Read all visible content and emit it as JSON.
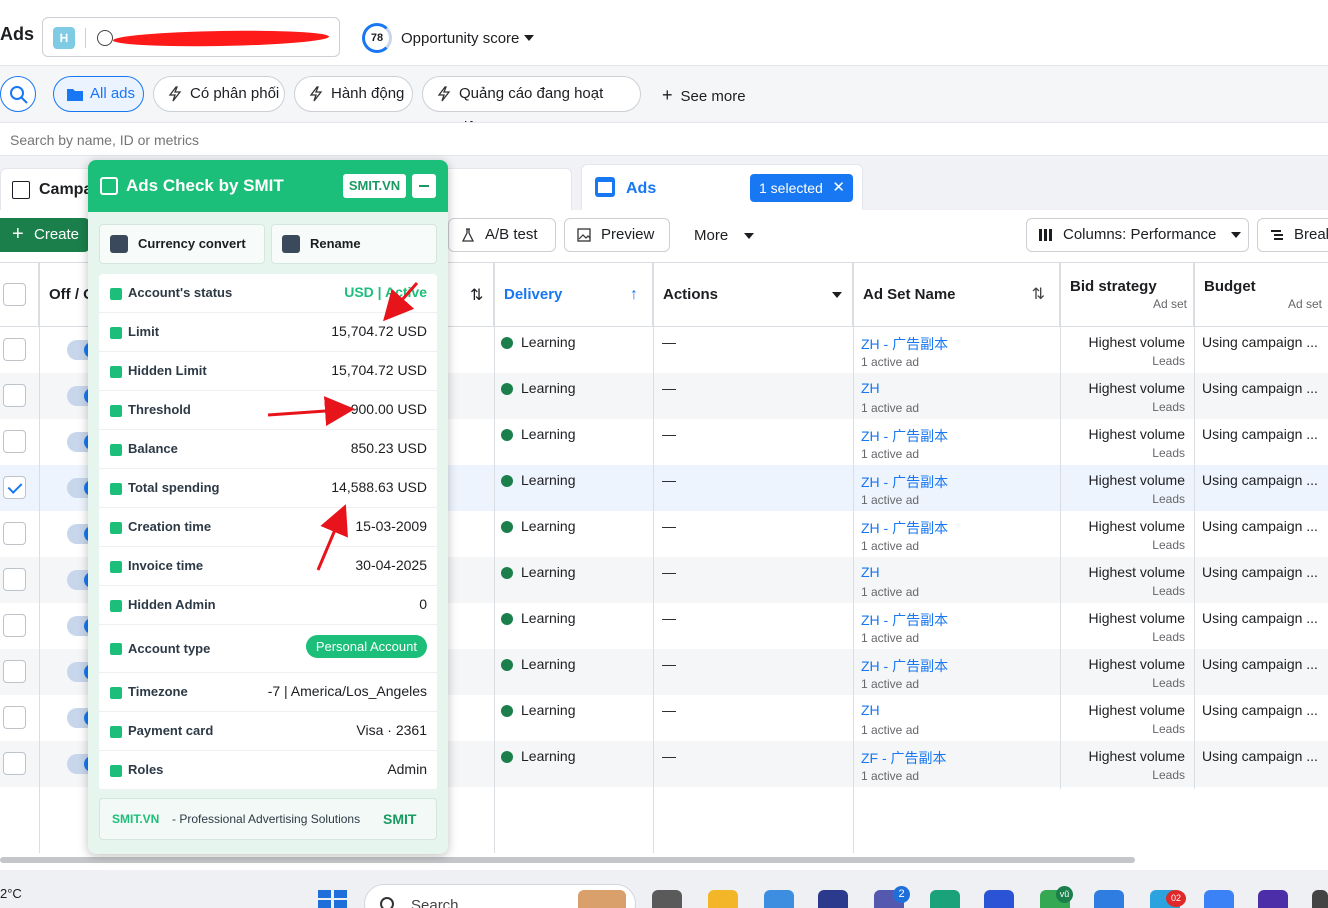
{
  "header": {
    "brand": "Ads",
    "account_badge": "H",
    "opportunity_score": "78",
    "opportunity_label": "Opportunity score"
  },
  "filters": {
    "chips": [
      {
        "label": "All ads"
      },
      {
        "label": "Có phân phối"
      },
      {
        "label": "Hành động"
      },
      {
        "label": "Quảng cáo đang hoạt động"
      }
    ],
    "see_more": "See more"
  },
  "search": {
    "placeholder": "Search by name, ID or metrics"
  },
  "tabs": {
    "campaigns": "Campa",
    "ads": "Ads",
    "selected": "1 selected"
  },
  "toolbar": {
    "create": "Create",
    "ab_test": "A/B test",
    "preview": "Preview",
    "more": "More",
    "columns": "Columns: Performance",
    "breakdown": "Break"
  },
  "table": {
    "headers": {
      "off_on": "Off / O",
      "delivery": "Delivery",
      "actions": "Actions",
      "ad_set_name": "Ad Set Name",
      "bid_strategy": "Bid strategy",
      "bid_strategy_sub": "Ad set",
      "budget": "Budget",
      "budget_sub": "Ad set"
    },
    "rows": [
      {
        "delivery": "Learning",
        "actions": "—",
        "ad_set": "ZH - 广告副本",
        "ad_set_sub": "1 active ad",
        "bid": "Highest volume",
        "bid_sub": "Leads",
        "budget": "Using campaign ...",
        "checked": false
      },
      {
        "delivery": "Learning",
        "actions": "—",
        "ad_set": "ZH",
        "ad_set_sub": "1 active ad",
        "bid": "Highest volume",
        "bid_sub": "Leads",
        "budget": "Using campaign ...",
        "checked": false
      },
      {
        "delivery": "Learning",
        "actions": "—",
        "ad_set": "ZH - 广告副本",
        "ad_set_sub": "1 active ad",
        "bid": "Highest volume",
        "bid_sub": "Leads",
        "budget": "Using campaign ...",
        "checked": false
      },
      {
        "delivery": "Learning",
        "actions": "—",
        "ad_set": "ZH - 广告副本",
        "ad_set_sub": "1 active ad",
        "bid": "Highest volume",
        "bid_sub": "Leads",
        "budget": "Using campaign ...",
        "checked": true
      },
      {
        "delivery": "Learning",
        "actions": "—",
        "ad_set": "ZH - 广告副本",
        "ad_set_sub": "1 active ad",
        "bid": "Highest volume",
        "bid_sub": "Leads",
        "budget": "Using campaign ...",
        "checked": false
      },
      {
        "delivery": "Learning",
        "actions": "—",
        "ad_set": "ZH",
        "ad_set_sub": "1 active ad",
        "bid": "Highest volume",
        "bid_sub": "Leads",
        "budget": "Using campaign ...",
        "checked": false
      },
      {
        "delivery": "Learning",
        "actions": "—",
        "ad_set": "ZH - 广告副本",
        "ad_set_sub": "1 active ad",
        "bid": "Highest volume",
        "bid_sub": "Leads",
        "budget": "Using campaign ...",
        "checked": false
      },
      {
        "delivery": "Learning",
        "actions": "—",
        "ad_set": "ZH - 广告副本",
        "ad_set_sub": "1 active ad",
        "bid": "Highest volume",
        "bid_sub": "Leads",
        "budget": "Using campaign ...",
        "checked": false
      },
      {
        "delivery": "Learning",
        "actions": "—",
        "ad_set": "ZH",
        "ad_set_sub": "1 active ad",
        "bid": "Highest volume",
        "bid_sub": "Leads",
        "budget": "Using campaign ...",
        "checked": false
      },
      {
        "delivery": "Learning",
        "actions": "—",
        "ad_set": "ZF - 广告副本",
        "ad_set_sub": "1 active ad",
        "bid": "Highest volume",
        "bid_sub": "Leads",
        "budget": "Using campaign ...",
        "checked": false
      }
    ]
  },
  "smit_panel": {
    "title": "Ads Check by SMIT",
    "badge": "SMIT.VN",
    "currency_convert": "Currency convert",
    "rename": "Rename",
    "rows": [
      {
        "key": "Account's status",
        "value": "USD | Active",
        "style": "green"
      },
      {
        "key": "Limit",
        "value": "15,704.72 USD",
        "style": ""
      },
      {
        "key": "Hidden Limit",
        "value": "15,704.72 USD",
        "style": ""
      },
      {
        "key": "Threshold",
        "value": "900.00 USD",
        "style": ""
      },
      {
        "key": "Balance",
        "value": "850.23 USD",
        "style": ""
      },
      {
        "key": "Total spending",
        "value": "14,588.63 USD",
        "style": ""
      },
      {
        "key": "Creation time",
        "value": "15-03-2009",
        "style": ""
      },
      {
        "key": "Invoice time",
        "value": "30-04-2025",
        "style": ""
      },
      {
        "key": "Hidden Admin",
        "value": "0",
        "style": ""
      },
      {
        "key": "Account type",
        "value": "Personal Account",
        "style": "pill"
      },
      {
        "key": "Timezone",
        "value": "-7 | America/Los_Angeles",
        "style": ""
      },
      {
        "key": "Payment card",
        "value": "Visa · 2361",
        "style": ""
      },
      {
        "key": "Roles",
        "value": "Admin",
        "style": ""
      }
    ],
    "footer_brand": "SMIT.VN",
    "footer_text": "- Professional Advertising Solutions",
    "footer_logo": "SMIT"
  },
  "taskbar": {
    "temperature": "2°C",
    "search": "Search",
    "teams_badge": "2",
    "app_badge": "vũ",
    "telegram_badge": "02"
  },
  "colors": {
    "accent": "#1877f2",
    "smit_green": "#1cbf79",
    "create_green": "#1a7f4b",
    "annotation_red": "#e8141b"
  }
}
